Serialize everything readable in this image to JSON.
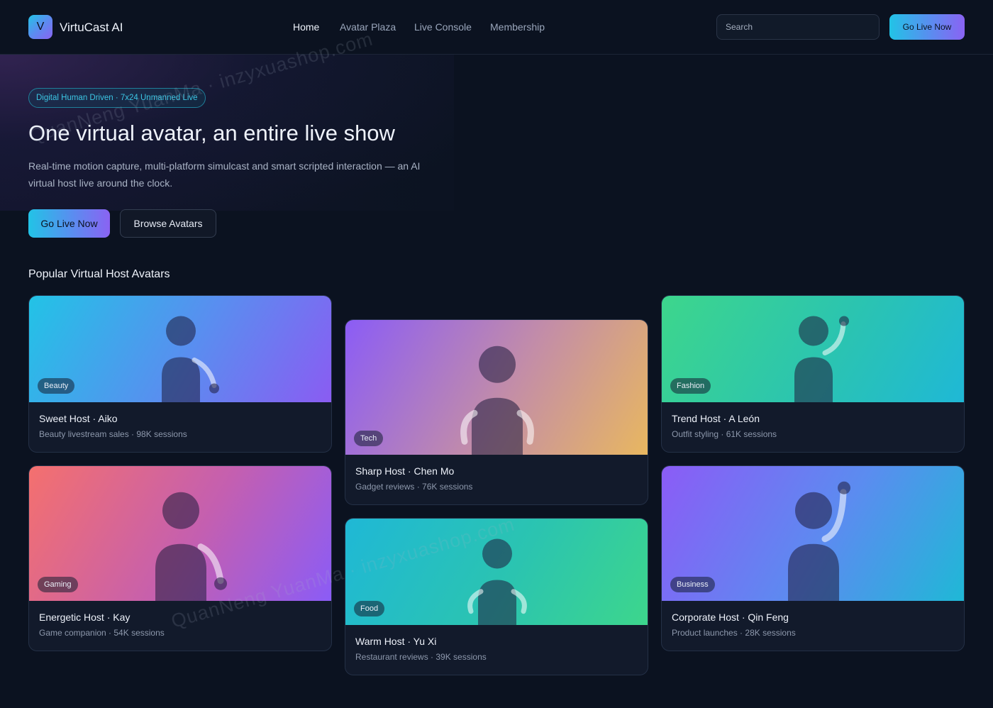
{
  "header": {
    "logo_letter": "V",
    "brand": "VirtuCast AI",
    "nav": [
      "Home",
      "Avatar Plaza",
      "Live Console",
      "Membership"
    ],
    "search_placeholder": "Search",
    "cta": "Go Live Now"
  },
  "hero": {
    "badge": "Digital Human Driven · 7x24 Unmanned Live",
    "title": "One virtual avatar, an entire live show",
    "description": "Real-time motion capture, multi-platform simulcast and smart scripted interaction — an AI virtual host live around the clock.",
    "primary_cta": "Go Live Now",
    "secondary_cta": "Browse Avatars"
  },
  "section_title": "Popular Virtual Host Avatars",
  "cards": [
    {
      "tag": "Beauty",
      "name": "Sweet Host · Aiko",
      "meta": "Beauty livestream sales · 98K sessions",
      "colors": [
        "#22c3e6",
        "#5b8cf0",
        "#8a5cf2"
      ]
    },
    {
      "tag": "Tech",
      "name": "Sharp Host · Chen Mo",
      "meta": "Gadget reviews · 76K sessions",
      "colors": [
        "#8b5cf6",
        "#c48ea6",
        "#e8b760"
      ]
    },
    {
      "tag": "Fashion",
      "name": "Trend Host · A León",
      "meta": "Outfit styling · 61K sessions",
      "colors": [
        "#3dd68c",
        "#2bc4b0",
        "#1fb8d6"
      ]
    },
    {
      "tag": "Gaming",
      "name": "Energetic Host · Kay",
      "meta": "Game companion · 54K sessions",
      "colors": [
        "#f4706e",
        "#c45fb0",
        "#8b5cf6"
      ]
    },
    {
      "tag": "Food",
      "name": "Warm Host · Yu Xi",
      "meta": "Restaurant reviews · 39K sessions",
      "colors": [
        "#1fb8d6",
        "#2bc4b0",
        "#3dd68c"
      ]
    },
    {
      "tag": "Business",
      "name": "Corporate Host · Qin Feng",
      "meta": "Product launches · 28K sessions",
      "colors": [
        "#8b5cf6",
        "#5b8cf0",
        "#1fb8d6"
      ]
    }
  ],
  "watermark": [
    "QuanNeng YuanMa · inzyxuashop.com",
    "QuanNeng YuanMa · inzyxuashop.com"
  ]
}
